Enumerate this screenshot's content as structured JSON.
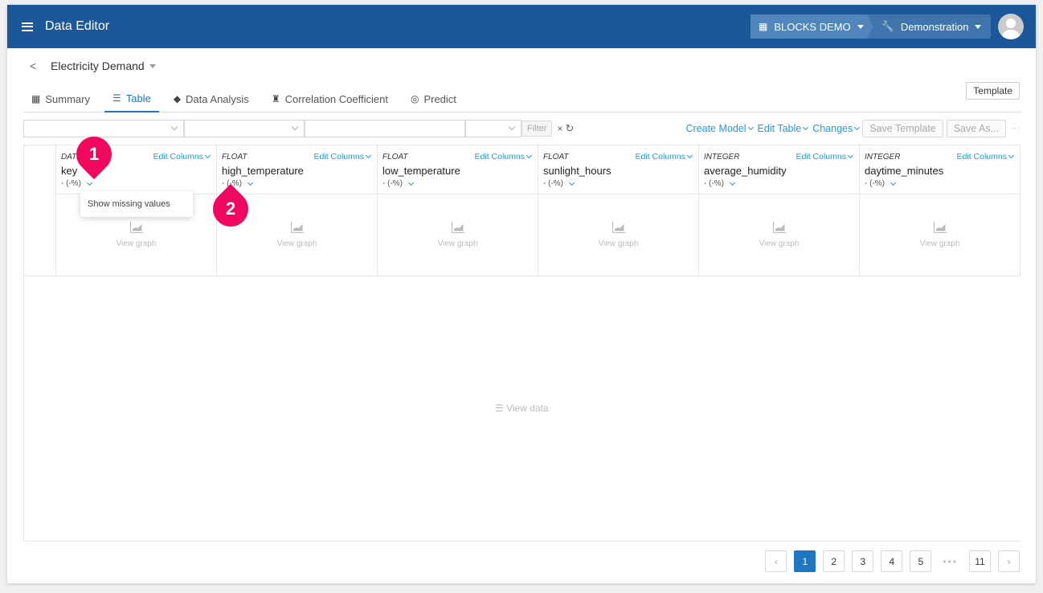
{
  "header": {
    "app_title": "Data Editor",
    "org": "BLOCKS DEMO",
    "project": "Demonstration",
    "menu_icon": "hamburger-icon",
    "org_icon": "building-icon",
    "project_icon": "wrench-icon",
    "avatar_icon": "user-avatar-icon"
  },
  "dataset": {
    "back_label": "<",
    "name": "Electricity Demand"
  },
  "tabs": [
    {
      "label": "Summary",
      "icon": "grid-icon",
      "active": false
    },
    {
      "label": "Table",
      "icon": "list-icon",
      "active": true
    },
    {
      "label": "Data Analysis",
      "icon": "analysis-icon",
      "active": false
    },
    {
      "label": "Correlation Coefficient",
      "icon": "lamp-icon",
      "active": false
    },
    {
      "label": "Predict",
      "icon": "predict-icon",
      "active": false
    }
  ],
  "template_button": "Template",
  "filter_bar": {
    "select1_value": "",
    "select2_value": "",
    "input_value": "",
    "select3_value": "",
    "filter_label": "Filter",
    "clear_label": "×",
    "reload_label": "↻"
  },
  "actions": {
    "create_model": "Create Model",
    "edit_table": "Edit Table",
    "changes": "Changes",
    "save_template": "Save Template",
    "save_as": "Save As...",
    "more": "···"
  },
  "columns": [
    {
      "type": "DATE",
      "name": "key",
      "missing": "- (-%)",
      "edit": "Edit Columns",
      "graph": "View graph"
    },
    {
      "type": "FLOAT",
      "name": "high_temperature",
      "missing": "- (-%)",
      "edit": "Edit Columns",
      "graph": "View graph"
    },
    {
      "type": "FLOAT",
      "name": "low_temperature",
      "missing": "- (-%)",
      "edit": "Edit Columns",
      "graph": "View graph"
    },
    {
      "type": "FLOAT",
      "name": "sunlight_hours",
      "missing": "- (-%)",
      "edit": "Edit Columns",
      "graph": "View graph"
    },
    {
      "type": "INTEGER",
      "name": "average_humidity",
      "missing": "- (-%)",
      "edit": "Edit Columns",
      "graph": "View graph"
    },
    {
      "type": "INTEGER",
      "name": "daytime_minutes",
      "missing": "- (-%)",
      "edit": "Edit Columns",
      "graph": "View graph"
    }
  ],
  "view_data": "☰ View data",
  "popup": {
    "label": "Show missing values"
  },
  "markers": [
    "1",
    "2"
  ],
  "pagination": {
    "prev": "‹",
    "pages": [
      "1",
      "2",
      "3",
      "4",
      "5"
    ],
    "ellipsis": "•••",
    "last": "11",
    "next": "›",
    "current": "1"
  }
}
